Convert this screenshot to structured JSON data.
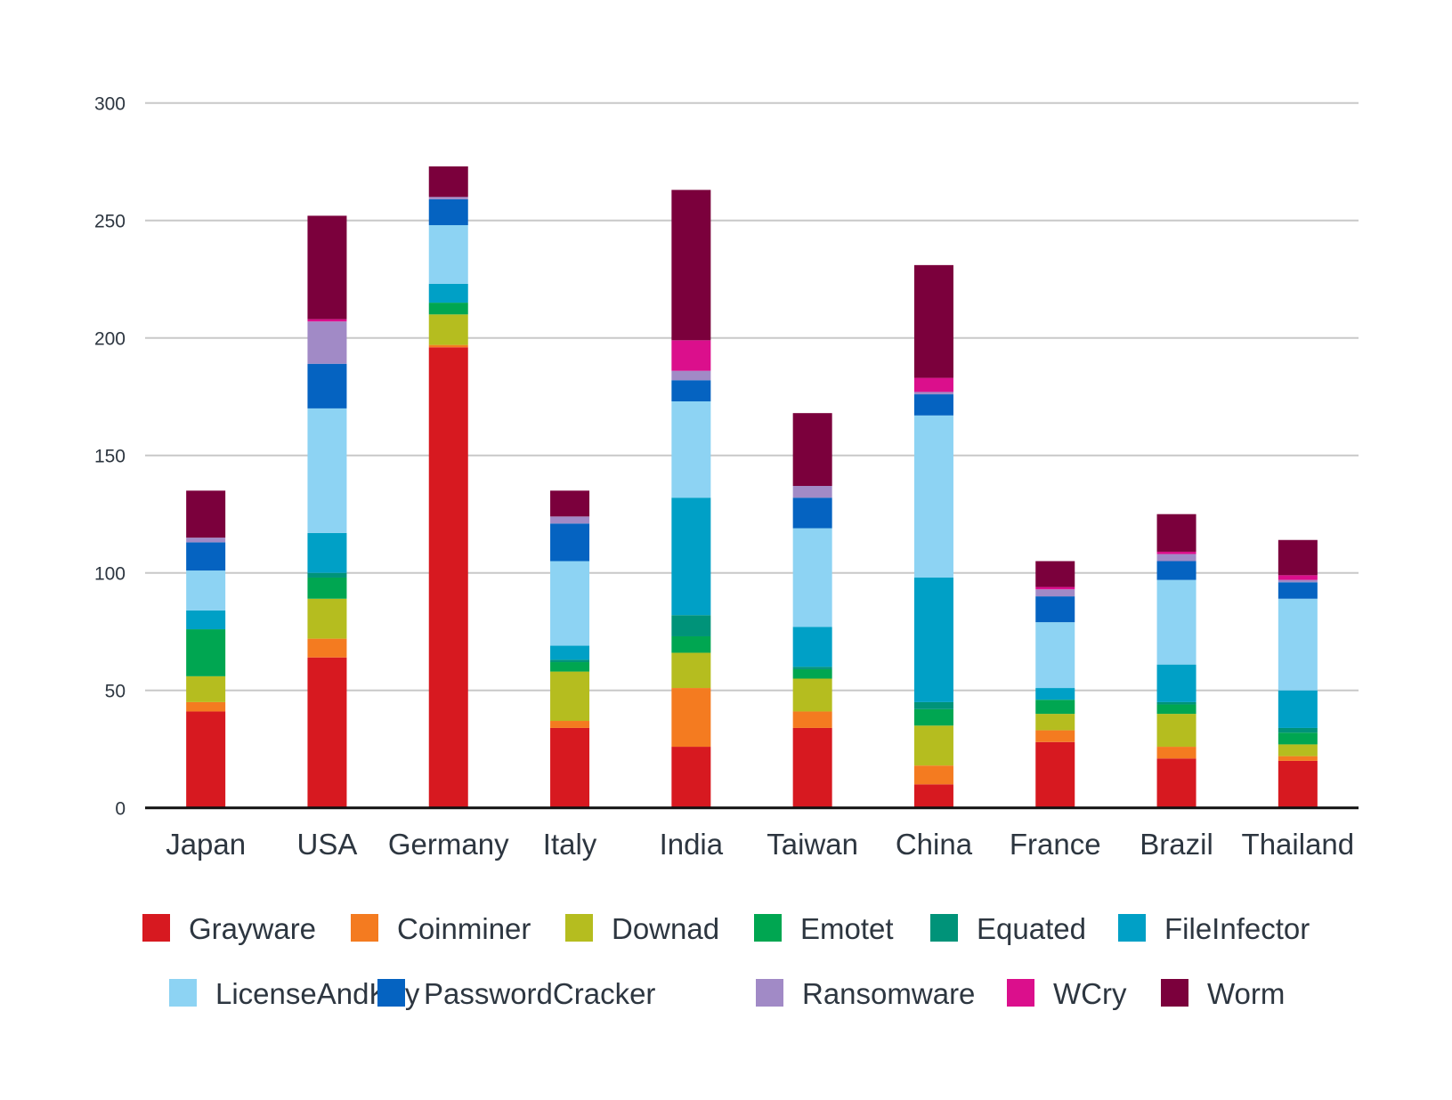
{
  "chart_data": {
    "type": "bar",
    "stacked": true,
    "title": "",
    "xlabel": "",
    "ylabel": "",
    "ylim": [
      0,
      300
    ],
    "yticks": [
      0,
      50,
      100,
      150,
      200,
      250,
      300
    ],
    "grid": true,
    "legend_position": "bottom",
    "categories": [
      "Japan",
      "USA",
      "Germany",
      "Italy",
      "India",
      "Taiwan",
      "China",
      "France",
      "Brazil",
      "Thailand"
    ],
    "series": [
      {
        "name": "Grayware",
        "color": "#d71920",
        "values": [
          41,
          64,
          196,
          34,
          26,
          34,
          10,
          28,
          21,
          20
        ]
      },
      {
        "name": "Coinminer",
        "color": "#f47b20",
        "values": [
          4,
          8,
          1,
          3,
          25,
          7,
          8,
          5,
          5,
          2
        ]
      },
      {
        "name": "Downad",
        "color": "#b5bd1f",
        "values": [
          11,
          17,
          13,
          21,
          15,
          14,
          17,
          7,
          14,
          5
        ]
      },
      {
        "name": "Emotet",
        "color": "#00a651",
        "values": [
          20,
          9,
          5,
          4,
          7,
          4,
          7,
          6,
          4,
          5
        ]
      },
      {
        "name": "Equated",
        "color": "#009379",
        "values": [
          0,
          2,
          0,
          1,
          9,
          1,
          3,
          0,
          1,
          2
        ]
      },
      {
        "name": "FileInfector",
        "color": "#00a0c6",
        "values": [
          8,
          17,
          8,
          6,
          50,
          17,
          53,
          5,
          16,
          16
        ]
      },
      {
        "name": "LicenseAndKey",
        "color": "#8dd3f3",
        "values": [
          17,
          53,
          25,
          36,
          41,
          42,
          69,
          28,
          36,
          39
        ]
      },
      {
        "name": "PasswordCracker",
        "color": "#0563c1",
        "values": [
          12,
          19,
          11,
          16,
          9,
          13,
          9,
          11,
          8,
          7
        ]
      },
      {
        "name": "Ransomware",
        "color": "#a18ac6",
        "values": [
          2,
          18,
          1,
          3,
          4,
          5,
          1,
          3,
          3,
          1
        ]
      },
      {
        "name": "WCry",
        "color": "#db0f8c",
        "values": [
          0,
          1,
          0,
          0,
          13,
          0,
          6,
          1,
          1,
          2
        ]
      },
      {
        "name": "Worm",
        "color": "#7b003c",
        "values": [
          20,
          44,
          13,
          11,
          64,
          31,
          48,
          11,
          16,
          15
        ]
      }
    ]
  }
}
